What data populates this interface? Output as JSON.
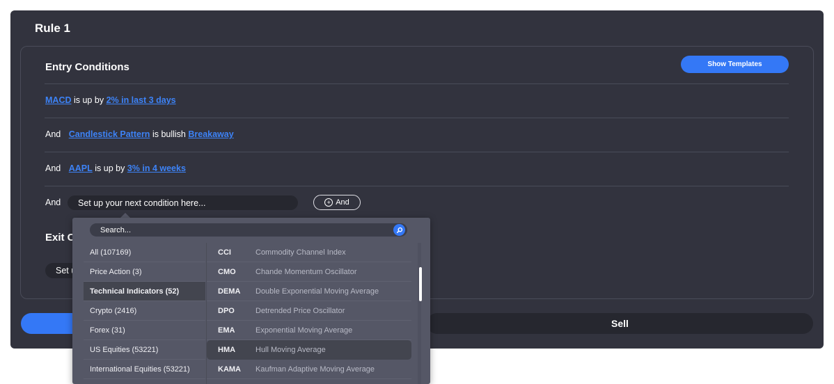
{
  "rule": {
    "title": "Rule 1"
  },
  "entry": {
    "title": "Entry Conditions",
    "show_templates": "Show Templates",
    "conditions": [
      {
        "connector": "",
        "indicator": "MACD",
        "text": "is up by",
        "value": "2% in last 3 days"
      },
      {
        "connector": "And",
        "indicator": "Candlestick Pattern",
        "text": "is bullish",
        "value": "Breakaway"
      },
      {
        "connector": "And",
        "indicator": "AAPL",
        "text": "is up by",
        "value": "3% in 4 weeks"
      }
    ],
    "next": {
      "connector": "And",
      "placeholder": "Set up your next condition here...",
      "and_button": "And"
    }
  },
  "exit": {
    "title": "Exit C",
    "input_text": "Set u"
  },
  "actions": {
    "buy": "",
    "sell": "Sell"
  },
  "dropdown": {
    "search_placeholder": "Search...",
    "categories": [
      {
        "label": "All (107169)",
        "selected": false
      },
      {
        "label": "Price Action (3)",
        "selected": false
      },
      {
        "label": "Technical Indicators (52)",
        "selected": true
      },
      {
        "label": "Crypto (2416)",
        "selected": false
      },
      {
        "label": "Forex (31)",
        "selected": false
      },
      {
        "label": "US Equities (53221)",
        "selected": false
      },
      {
        "label": "International Equities (53221)",
        "selected": false
      }
    ],
    "indicators": [
      {
        "code": "CCI",
        "name": "Commodity Channel Index",
        "highlighted": false
      },
      {
        "code": "CMO",
        "name": "Chande Momentum Oscillator",
        "highlighted": false
      },
      {
        "code": "DEMA",
        "name": "Double Exponential Moving Average",
        "highlighted": false
      },
      {
        "code": "DPO",
        "name": "Detrended Price Oscillator",
        "highlighted": false
      },
      {
        "code": "EMA",
        "name": "Exponential Moving Average",
        "highlighted": false
      },
      {
        "code": "HMA",
        "name": "Hull Moving Average",
        "highlighted": true
      },
      {
        "code": "KAMA",
        "name": "Kaufman Adaptive Moving Average",
        "highlighted": false
      }
    ]
  },
  "colors": {
    "accent": "#3478f6",
    "card": "#32333e",
    "dropdown": "#555766",
    "link": "#3d83f7"
  }
}
